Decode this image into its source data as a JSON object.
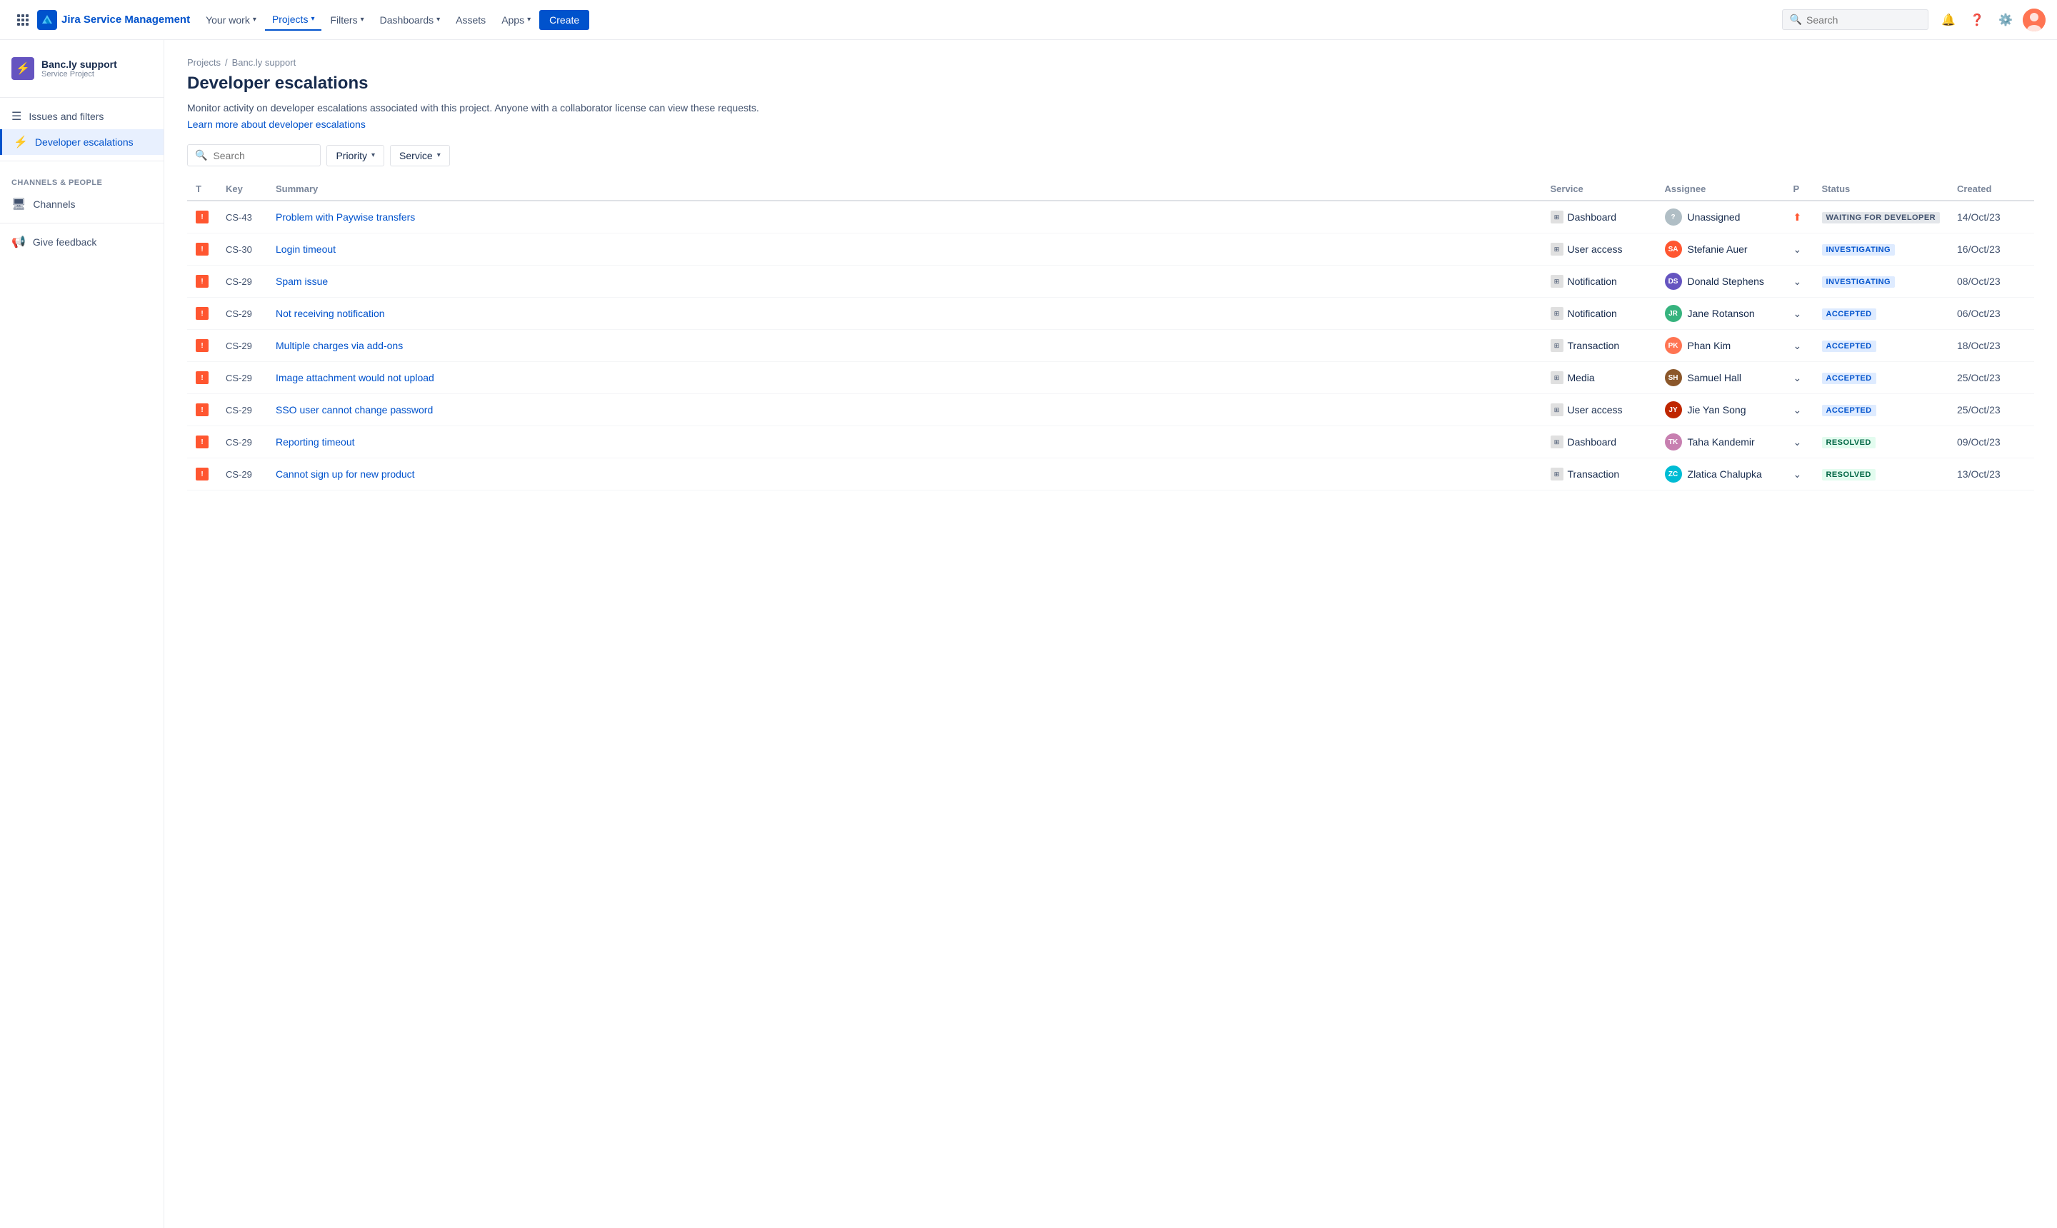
{
  "topnav": {
    "logo_text": "Jira Service Management",
    "nav_items": [
      {
        "label": "Your work",
        "has_chevron": true
      },
      {
        "label": "Projects",
        "has_chevron": true,
        "active": true
      },
      {
        "label": "Filters",
        "has_chevron": true
      },
      {
        "label": "Dashboards",
        "has_chevron": true
      },
      {
        "label": "Assets"
      },
      {
        "label": "Apps",
        "has_chevron": true
      }
    ],
    "create_label": "Create",
    "search_placeholder": "Search"
  },
  "sidebar": {
    "project_name": "Banc.ly support",
    "project_type": "Service Project",
    "nav_items": [
      {
        "label": "Issues and filters",
        "icon": "☰",
        "active": false
      },
      {
        "label": "Developer escalations",
        "icon": "⚡",
        "active": true
      }
    ],
    "section_label": "CHANNELS & PEOPLE",
    "bottom_items": [
      {
        "label": "Channels",
        "icon": "🖥"
      },
      {
        "label": "Give feedback",
        "icon": "📢"
      }
    ]
  },
  "breadcrumb": {
    "items": [
      "Projects",
      "Banc.ly support"
    ],
    "sep": "/"
  },
  "page": {
    "title": "Developer escalations",
    "description": "Monitor activity on developer escalations associated with this project. Anyone with a collaborator license can view these requests.",
    "link_text": "Learn more about developer escalations"
  },
  "filters": {
    "search_placeholder": "Search",
    "priority_label": "Priority",
    "service_label": "Service"
  },
  "table": {
    "columns": [
      "T",
      "Key",
      "Summary",
      "Service",
      "Assignee",
      "P",
      "Status",
      "Created"
    ],
    "rows": [
      {
        "key": "CS-43",
        "summary": "Problem with Paywise transfers",
        "service": "Dashboard",
        "assignee_name": "Unassigned",
        "assignee_color": "#b0bec5",
        "priority": "up",
        "status": "WAITING FOR DEVELOPER",
        "status_class": "status-waiting",
        "created": "14/Oct/23"
      },
      {
        "key": "CS-30",
        "summary": "Login timeout",
        "service": "User access",
        "assignee_name": "Stefanie Auer",
        "assignee_color": "#ff5630",
        "priority": "down",
        "status": "INVESTIGATING",
        "status_class": "status-investigating",
        "created": "16/Oct/23"
      },
      {
        "key": "CS-29",
        "summary": "Spam issue",
        "service": "Notification",
        "assignee_name": "Donald Stephens",
        "assignee_color": "#6554c0",
        "priority": "down",
        "status": "INVESTIGATING",
        "status_class": "status-investigating",
        "created": "08/Oct/23"
      },
      {
        "key": "CS-29",
        "summary": "Not receiving notification",
        "service": "Notification",
        "assignee_name": "Jane Rotanson",
        "assignee_color": "#36b37e",
        "priority": "down",
        "status": "ACCEPTED",
        "status_class": "status-accepted",
        "created": "06/Oct/23"
      },
      {
        "key": "CS-29",
        "summary": "Multiple charges via add-ons",
        "service": "Transaction",
        "assignee_name": "Phan Kim",
        "assignee_color": "#ff7452",
        "priority": "down",
        "status": "ACCEPTED",
        "status_class": "status-accepted",
        "created": "18/Oct/23"
      },
      {
        "key": "CS-29",
        "summary": "Image attachment would not upload",
        "service": "Media",
        "assignee_name": "Samuel Hall",
        "assignee_color": "#8b572a",
        "priority": "down",
        "status": "ACCEPTED",
        "status_class": "status-accepted",
        "created": "25/Oct/23"
      },
      {
        "key": "CS-29",
        "summary": "SSO user cannot change password",
        "service": "User access",
        "assignee_name": "Jie Yan Song",
        "assignee_color": "#bf2600",
        "priority": "down",
        "status": "ACCEPTED",
        "status_class": "status-accepted",
        "created": "25/Oct/23"
      },
      {
        "key": "CS-29",
        "summary": "Reporting timeout",
        "service": "Dashboard",
        "assignee_name": "Taha Kandemir",
        "assignee_color": "#c77fb0",
        "priority": "down",
        "status": "RESOLVED",
        "status_class": "status-resolved",
        "created": "09/Oct/23"
      },
      {
        "key": "CS-29",
        "summary": "Cannot sign up for new product",
        "service": "Transaction",
        "assignee_name": "Zlatica Chalupka",
        "assignee_color": "#00bcd4",
        "priority": "down",
        "status": "RESOLVED",
        "status_class": "status-resolved",
        "created": "13/Oct/23"
      }
    ]
  }
}
